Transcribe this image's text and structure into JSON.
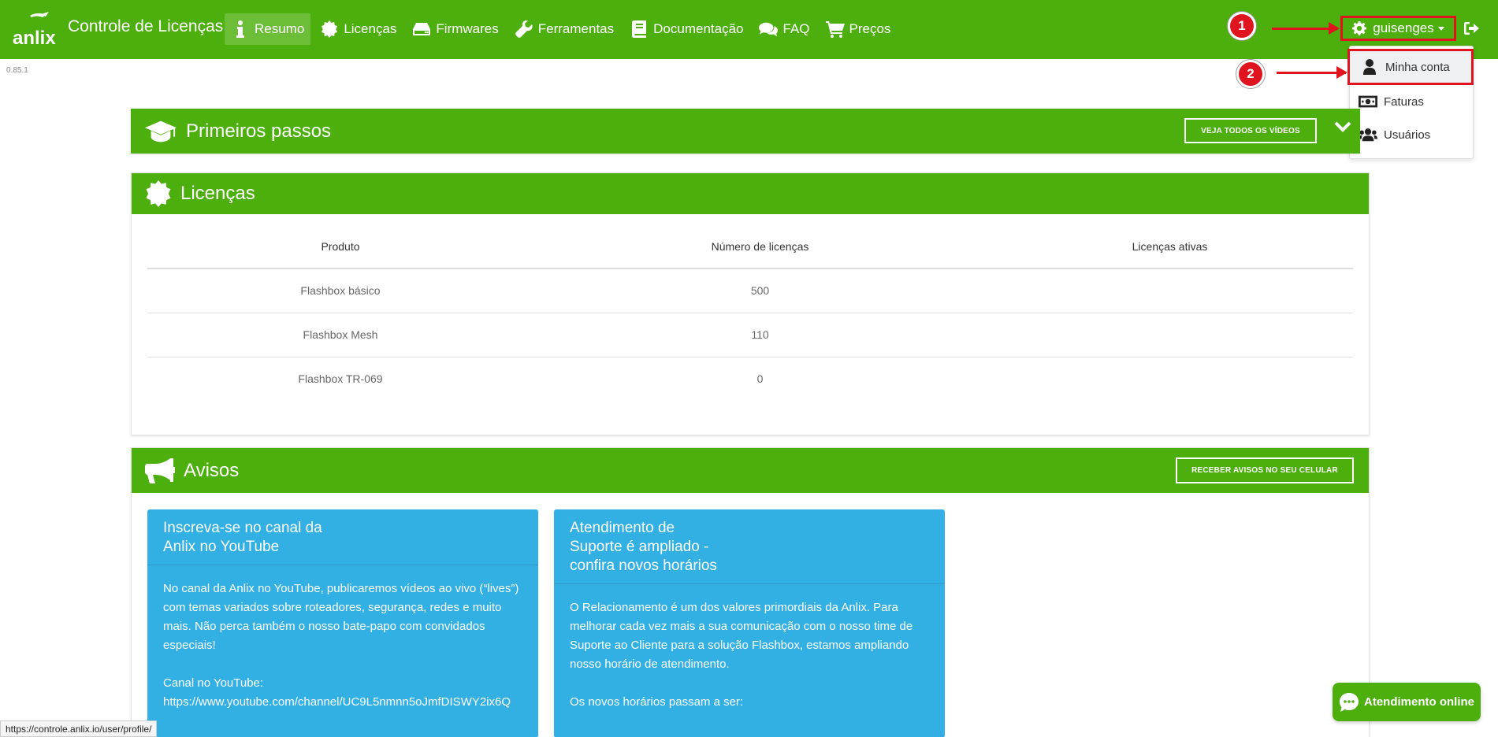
{
  "app": {
    "logo_text": "anlix",
    "brand": "Controle de Licenças",
    "version": "0.85.1"
  },
  "nav": {
    "items": [
      {
        "label": "Resumo",
        "icon": "info-icon",
        "active": true
      },
      {
        "label": "Licenças",
        "icon": "badge-icon"
      },
      {
        "label": "Firmwares",
        "icon": "hdd-icon"
      },
      {
        "label": "Ferramentas",
        "icon": "wrench-icon"
      },
      {
        "label": "Documentação",
        "icon": "book-icon"
      },
      {
        "label": "FAQ",
        "icon": "comments-icon"
      },
      {
        "label": "Preços",
        "icon": "cart-icon"
      }
    ],
    "user": "guisenges"
  },
  "user_dropdown": {
    "items": [
      {
        "label": "Minha conta",
        "icon": "user-icon"
      },
      {
        "label": "Faturas",
        "icon": "money-icon"
      },
      {
        "label": "Usuários",
        "icon": "users-icon"
      }
    ]
  },
  "callouts": {
    "first": "1",
    "second": "2"
  },
  "primeiros_passos": {
    "title": "Primeiros passos",
    "button": "VEJA TODOS OS VÍDEOS"
  },
  "licencas": {
    "title": "Licenças",
    "columns": [
      "Produto",
      "Número de licenças",
      "Licenças ativas"
    ],
    "rows": [
      {
        "product": "Flashbox básico",
        "count": "500",
        "active": ""
      },
      {
        "product": "Flashbox Mesh",
        "count": "110",
        "active": ""
      },
      {
        "product": "Flashbox TR-069",
        "count": "0",
        "active": ""
      }
    ]
  },
  "avisos": {
    "title": "Avisos",
    "button": "RECEBER AVISOS NO SEU CELULAR",
    "cards": [
      {
        "title_line1": "Inscreva-se no canal da",
        "title_line2": "Anlix no YouTube",
        "para1": "No canal da Anlix no YouTube, publicaremos vídeos ao vivo (“lives”) com temas variados sobre roteadores, segurança, redes e muito mais. Não perca também o nosso bate-papo com convidados especiais!",
        "para2_label": "Canal no YouTube:",
        "para2_link": "https://www.youtube.com/channel/UC9L5nmnn5oJmfDISWY2ix6Q"
      },
      {
        "title_line1": "Atendimento de",
        "title_line2": "Suporte é ampliado -",
        "title_line3": "confira novos horários",
        "para1": "O Relacionamento é um dos valores primordiais da Anlix. Para melhorar cada vez mais a sua comunicação com o nosso time de Suporte ao Cliente para a solução Flashbox, estamos ampliando nosso horário de atendimento.",
        "para2": "Os novos horários passam a ser:"
      }
    ]
  },
  "status_bar": {
    "url": "https://controle.anlix.io/user/profile/"
  },
  "chat": {
    "label": "Atendimento online"
  }
}
